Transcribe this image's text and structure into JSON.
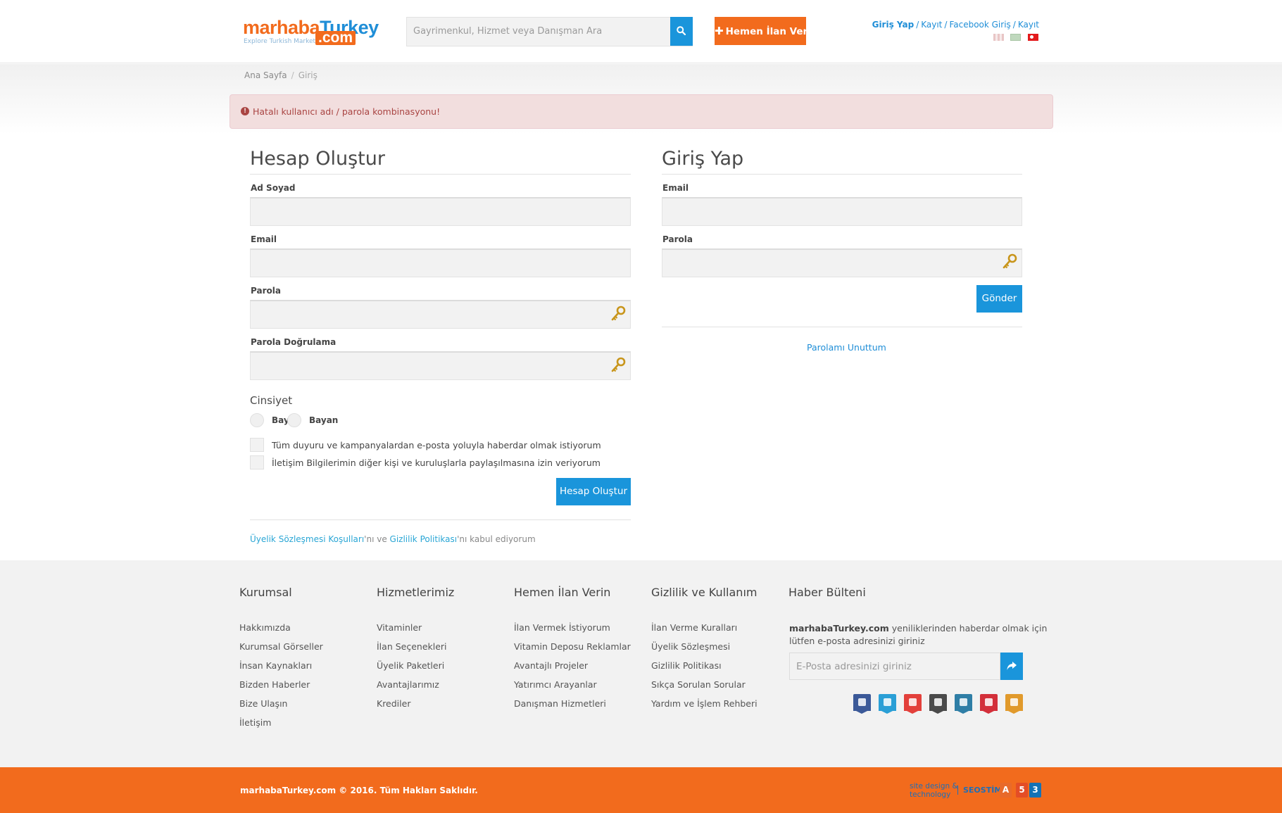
{
  "header": {
    "logo_main_1": "marhaba",
    "logo_main_2": "Turkey",
    "logo_com": ".com",
    "logo_tagline": "Explore Turkish Market",
    "search_placeholder": "Gayrimenkul, Hizmet veya Danışman Ara",
    "post_ad_label": "Hemen İlan Ver",
    "links": {
      "login": "Giriş Yap",
      "register": "Kayıt",
      "facebook_login": "Facebook Giriş",
      "register2": "Kayıt"
    },
    "icons": {
      "search": "search-icon",
      "plus": "plus-icon"
    }
  },
  "breadcrumb": {
    "home": "Ana Sayfa",
    "current": "Giriş"
  },
  "alert": {
    "message": "Hatalı kullanıcı adı / parola kombinasyonu!"
  },
  "register": {
    "title": "Hesap Oluştur",
    "name_label": "Ad Soyad",
    "email_label": "Email",
    "password_label": "Parola",
    "password_confirm_label": "Parola Doğrulama",
    "gender_title": "Cinsiyet",
    "gender_male": "Bay",
    "gender_female": "Bayan",
    "consent_email": "Tüm duyuru ve kampanyalardan e-posta yoluyla haberdar olmak istiyorum",
    "consent_share": "İletişim Bilgilerimin diğer kişi ve kuruluşlarla paylaşılmasına izin veriyorum",
    "submit_label": "Hesap Oluştur",
    "terms_link": "Üyelik Sözleşmesi Koşulları",
    "terms_mid": "'nı ve ",
    "privacy_link": "Gizlilik Politikası",
    "terms_end": "'nı kabul ediyorum"
  },
  "login": {
    "title": "Giriş Yap",
    "email_label": "Email",
    "password_label": "Parola",
    "submit_label": "Gönder",
    "forgot_label": "Parolamı Unuttum"
  },
  "footer": {
    "columns": [
      {
        "title": "Kurumsal",
        "items": [
          "Hakkımızda",
          "Kurumsal Görseller",
          "İnsan Kaynakları",
          "Bizden Haberler",
          "Bize Ulaşın",
          "İletişim"
        ]
      },
      {
        "title": "Hizmetlerimiz",
        "items": [
          "Vitaminler",
          "İlan Seçenekleri",
          "Üyelik Paketleri",
          "Avantajlarımız",
          "Krediler"
        ]
      },
      {
        "title": "Hemen İlan Verin",
        "items": [
          "İlan Vermek İstiyorum",
          "Vitamin Deposu Reklamlar",
          "Avantajlı Projeler",
          "Yatırımcı Arayanlar",
          "Danışman Hizmetleri"
        ]
      },
      {
        "title": "Gizlilik ve Kullanım",
        "items": [
          "İlan Verme Kuralları",
          "Üyelik Sözleşmesi",
          "Gizlilik Politikası",
          "Sıkça Sorulan Sorular",
          "Yardım ve İşlem Rehberi"
        ]
      }
    ],
    "newsletter": {
      "title": "Haber Bülteni",
      "brand": "marhabaTurkey.com",
      "text": " yeniliklerinden haberdar olmak için lütfen e-posta adresinizi giriniz",
      "placeholder": "E-Posta adresinizi giriniz"
    },
    "social": [
      {
        "name": "facebook-icon",
        "color": "#3b5998"
      },
      {
        "name": "twitter-icon",
        "color": "#2a9fd6"
      },
      {
        "name": "youtube-icon",
        "color": "#e3403b"
      },
      {
        "name": "googleplus-icon",
        "color": "#4a4a4a"
      },
      {
        "name": "instagram-icon",
        "color": "#2f7ea6"
      },
      {
        "name": "pinterest-icon",
        "color": "#d32f3a"
      },
      {
        "name": "rss-icon",
        "color": "#e19a2c"
      }
    ],
    "copyright": "marhabaTurkey.com © 2016. Tüm Hakları Saklıdır.",
    "design_credit_1": "site design &",
    "design_credit_2": "technology",
    "design_company": "SEOSTİM",
    "tech_badges": [
      "A",
      "5",
      "3"
    ]
  },
  "colors": {
    "orange": "#f26b1d",
    "blue": "#1a95db",
    "alert_bg": "#f2dede",
    "alert_text": "#a94442"
  }
}
